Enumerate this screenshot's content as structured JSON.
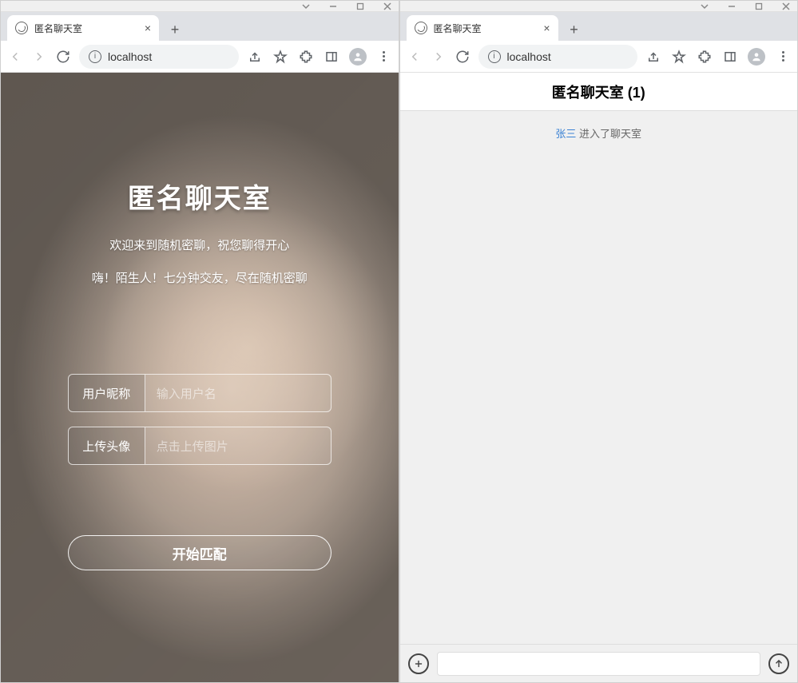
{
  "windows": {
    "left": {
      "tab_title": "匿名聊天室",
      "url": "localhost"
    },
    "right": {
      "tab_title": "匿名聊天室",
      "url": "localhost"
    }
  },
  "login": {
    "title": "匿名聊天室",
    "subtitle1": "欢迎来到随机密聊，祝您聊得开心",
    "subtitle2": "嗨！陌生人！七分钟交友，尽在随机密聊",
    "nickname_label": "用户昵称",
    "nickname_placeholder": "输入用户名",
    "avatar_label": "上传头像",
    "avatar_placeholder": "点击上传图片",
    "start_button": "开始匹配"
  },
  "chat": {
    "header": "匿名聊天室 (1)",
    "system_message": {
      "user": "张三",
      "action": " 进入了聊天室"
    }
  }
}
